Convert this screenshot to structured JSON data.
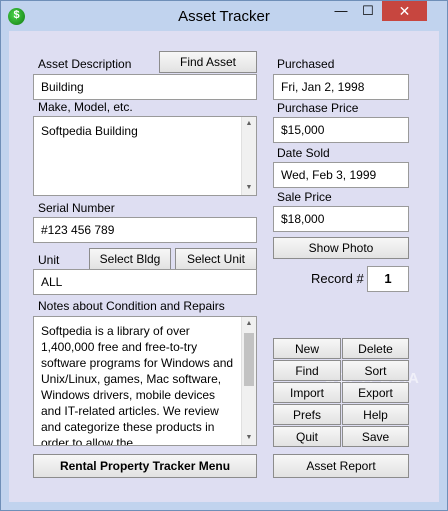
{
  "window": {
    "title": "Asset Tracker",
    "icon": "dollar-icon",
    "icon_glyph": "$"
  },
  "controls": {
    "minimize": "—",
    "maximize": "☐",
    "close": "✕"
  },
  "left": {
    "asset_description_label": "Asset Description",
    "find_asset_button": "Find Asset",
    "asset_description_value": "Building",
    "make_model_label": "Make, Model, etc.",
    "make_model_value": "Softpedia Building",
    "serial_label": "Serial Number",
    "serial_value": "#123 456 789",
    "unit_label": "Unit",
    "select_bldg_button": "Select Bldg",
    "select_unit_button": "Select Unit",
    "unit_value": "ALL",
    "notes_label": "Notes about Condition and Repairs",
    "notes_value": "Softpedia is a library of over 1,400,000 free and free-to-try software programs for Windows and Unix/Linux, games, Mac software, Windows drivers, mobile devices and IT-related articles. We review and categorize these products in order to allow the",
    "rental_menu_button": "Rental Property Tracker Menu"
  },
  "right": {
    "purchased_label": "Purchased",
    "purchased_value": "Fri, Jan 2, 1998",
    "purchase_price_label": "Purchase Price",
    "purchase_price_value": "$15,000",
    "date_sold_label": "Date Sold",
    "date_sold_value": "Wed, Feb 3, 1999",
    "sale_price_label": "Sale Price",
    "sale_price_value": "$18,000",
    "show_photo_button": "Show Photo",
    "record_label": "Record #",
    "record_value": "1",
    "actions": {
      "new": "New",
      "delete": "Delete",
      "find": "Find",
      "sort": "Sort",
      "import": "Import",
      "export": "Export",
      "prefs": "Prefs",
      "help": "Help",
      "quit": "Quit",
      "save": "Save"
    },
    "asset_report_button": "Asset Report"
  },
  "watermark": "SOFTPEDIA"
}
